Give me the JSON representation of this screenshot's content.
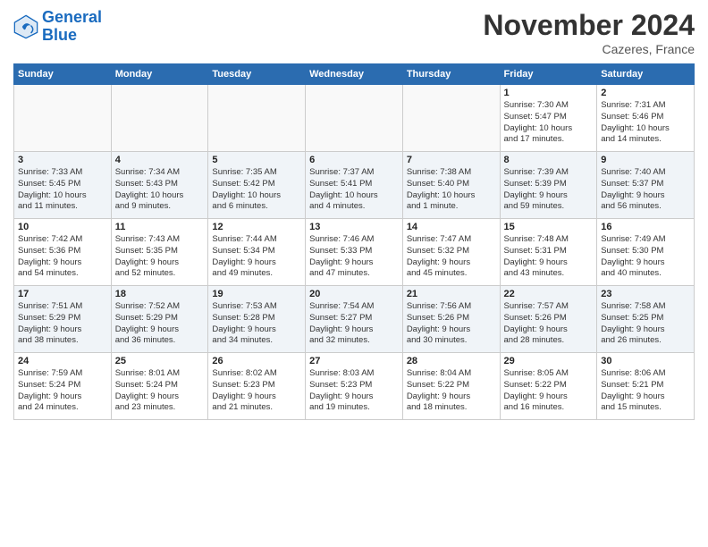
{
  "header": {
    "logo_line1": "General",
    "logo_line2": "Blue",
    "month": "November 2024",
    "location": "Cazeres, France"
  },
  "weekdays": [
    "Sunday",
    "Monday",
    "Tuesday",
    "Wednesday",
    "Thursday",
    "Friday",
    "Saturday"
  ],
  "weeks": [
    [
      {
        "day": "",
        "info": ""
      },
      {
        "day": "",
        "info": ""
      },
      {
        "day": "",
        "info": ""
      },
      {
        "day": "",
        "info": ""
      },
      {
        "day": "",
        "info": ""
      },
      {
        "day": "1",
        "info": "Sunrise: 7:30 AM\nSunset: 5:47 PM\nDaylight: 10 hours\nand 17 minutes."
      },
      {
        "day": "2",
        "info": "Sunrise: 7:31 AM\nSunset: 5:46 PM\nDaylight: 10 hours\nand 14 minutes."
      }
    ],
    [
      {
        "day": "3",
        "info": "Sunrise: 7:33 AM\nSunset: 5:45 PM\nDaylight: 10 hours\nand 11 minutes."
      },
      {
        "day": "4",
        "info": "Sunrise: 7:34 AM\nSunset: 5:43 PM\nDaylight: 10 hours\nand 9 minutes."
      },
      {
        "day": "5",
        "info": "Sunrise: 7:35 AM\nSunset: 5:42 PM\nDaylight: 10 hours\nand 6 minutes."
      },
      {
        "day": "6",
        "info": "Sunrise: 7:37 AM\nSunset: 5:41 PM\nDaylight: 10 hours\nand 4 minutes."
      },
      {
        "day": "7",
        "info": "Sunrise: 7:38 AM\nSunset: 5:40 PM\nDaylight: 10 hours\nand 1 minute."
      },
      {
        "day": "8",
        "info": "Sunrise: 7:39 AM\nSunset: 5:39 PM\nDaylight: 9 hours\nand 59 minutes."
      },
      {
        "day": "9",
        "info": "Sunrise: 7:40 AM\nSunset: 5:37 PM\nDaylight: 9 hours\nand 56 minutes."
      }
    ],
    [
      {
        "day": "10",
        "info": "Sunrise: 7:42 AM\nSunset: 5:36 PM\nDaylight: 9 hours\nand 54 minutes."
      },
      {
        "day": "11",
        "info": "Sunrise: 7:43 AM\nSunset: 5:35 PM\nDaylight: 9 hours\nand 52 minutes."
      },
      {
        "day": "12",
        "info": "Sunrise: 7:44 AM\nSunset: 5:34 PM\nDaylight: 9 hours\nand 49 minutes."
      },
      {
        "day": "13",
        "info": "Sunrise: 7:46 AM\nSunset: 5:33 PM\nDaylight: 9 hours\nand 47 minutes."
      },
      {
        "day": "14",
        "info": "Sunrise: 7:47 AM\nSunset: 5:32 PM\nDaylight: 9 hours\nand 45 minutes."
      },
      {
        "day": "15",
        "info": "Sunrise: 7:48 AM\nSunset: 5:31 PM\nDaylight: 9 hours\nand 43 minutes."
      },
      {
        "day": "16",
        "info": "Sunrise: 7:49 AM\nSunset: 5:30 PM\nDaylight: 9 hours\nand 40 minutes."
      }
    ],
    [
      {
        "day": "17",
        "info": "Sunrise: 7:51 AM\nSunset: 5:29 PM\nDaylight: 9 hours\nand 38 minutes."
      },
      {
        "day": "18",
        "info": "Sunrise: 7:52 AM\nSunset: 5:29 PM\nDaylight: 9 hours\nand 36 minutes."
      },
      {
        "day": "19",
        "info": "Sunrise: 7:53 AM\nSunset: 5:28 PM\nDaylight: 9 hours\nand 34 minutes."
      },
      {
        "day": "20",
        "info": "Sunrise: 7:54 AM\nSunset: 5:27 PM\nDaylight: 9 hours\nand 32 minutes."
      },
      {
        "day": "21",
        "info": "Sunrise: 7:56 AM\nSunset: 5:26 PM\nDaylight: 9 hours\nand 30 minutes."
      },
      {
        "day": "22",
        "info": "Sunrise: 7:57 AM\nSunset: 5:26 PM\nDaylight: 9 hours\nand 28 minutes."
      },
      {
        "day": "23",
        "info": "Sunrise: 7:58 AM\nSunset: 5:25 PM\nDaylight: 9 hours\nand 26 minutes."
      }
    ],
    [
      {
        "day": "24",
        "info": "Sunrise: 7:59 AM\nSunset: 5:24 PM\nDaylight: 9 hours\nand 24 minutes."
      },
      {
        "day": "25",
        "info": "Sunrise: 8:01 AM\nSunset: 5:24 PM\nDaylight: 9 hours\nand 23 minutes."
      },
      {
        "day": "26",
        "info": "Sunrise: 8:02 AM\nSunset: 5:23 PM\nDaylight: 9 hours\nand 21 minutes."
      },
      {
        "day": "27",
        "info": "Sunrise: 8:03 AM\nSunset: 5:23 PM\nDaylight: 9 hours\nand 19 minutes."
      },
      {
        "day": "28",
        "info": "Sunrise: 8:04 AM\nSunset: 5:22 PM\nDaylight: 9 hours\nand 18 minutes."
      },
      {
        "day": "29",
        "info": "Sunrise: 8:05 AM\nSunset: 5:22 PM\nDaylight: 9 hours\nand 16 minutes."
      },
      {
        "day": "30",
        "info": "Sunrise: 8:06 AM\nSunset: 5:21 PM\nDaylight: 9 hours\nand 15 minutes."
      }
    ]
  ]
}
